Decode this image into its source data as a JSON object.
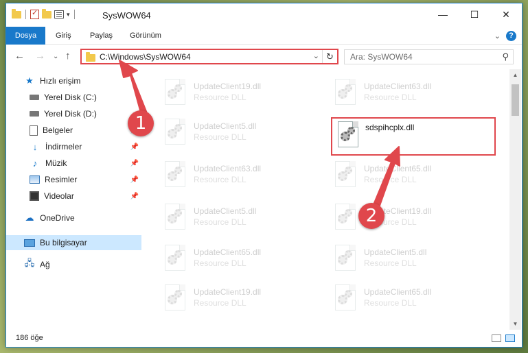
{
  "window": {
    "title": "SysWOW64",
    "controls": {
      "minimize": "—",
      "maximize": "☐",
      "close": "✕"
    }
  },
  "ribbon": {
    "tabs": [
      "Dosya",
      "Giriş",
      "Paylaş",
      "Görünüm"
    ],
    "help": "?"
  },
  "address": {
    "path": "C:\\Windows\\SysWOW64",
    "search_placeholder": "Ara: SysWOW64"
  },
  "sidebar": {
    "items": [
      {
        "label": "Hızlı erişim",
        "icon": "star-icon"
      },
      {
        "label": "Yerel Disk (C:)",
        "icon": "drive-icon"
      },
      {
        "label": "Yerel Disk (D:)",
        "icon": "drive-icon"
      },
      {
        "label": "Belgeler",
        "icon": "documents-icon"
      },
      {
        "label": "İndirmeler",
        "icon": "downloads-icon"
      },
      {
        "label": "Müzik",
        "icon": "music-icon"
      },
      {
        "label": "Resimler",
        "icon": "pictures-icon"
      },
      {
        "label": "Videolar",
        "icon": "videos-icon"
      },
      {
        "label": "OneDrive",
        "icon": "cloud-icon"
      },
      {
        "label": "Bu bilgisayar",
        "icon": "computer-icon"
      },
      {
        "label": "Ağ",
        "icon": "network-icon"
      }
    ]
  },
  "files": [
    {
      "name": "UpdateClient19.dll",
      "type": "Resource DLL"
    },
    {
      "name": "UpdateClient63.dll",
      "type": "Resource DLL"
    },
    {
      "name": "UpdateClient5.dll",
      "type": "Resource DLL"
    },
    {
      "name": "sdspihcplx.dll",
      "type": ""
    },
    {
      "name": "UpdateClient63.dll",
      "type": "Resource DLL"
    },
    {
      "name": "UpdateClient65.dll",
      "type": "Resource DLL"
    },
    {
      "name": "UpdateClient5.dll",
      "type": "Resource DLL"
    },
    {
      "name": "UpdateClient19.dll",
      "type": "Resource DLL"
    },
    {
      "name": "UpdateClient65.dll",
      "type": "Resource DLL"
    },
    {
      "name": "UpdateClient5.dll",
      "type": "Resource DLL"
    },
    {
      "name": "UpdateClient19.dll",
      "type": "Resource DLL"
    },
    {
      "name": "UpdateClient65.dll",
      "type": "Resource DLL"
    }
  ],
  "status": {
    "count": "186 öğe"
  },
  "annotations": {
    "step1": "1",
    "step2": "2",
    "color": "#e0474c"
  }
}
